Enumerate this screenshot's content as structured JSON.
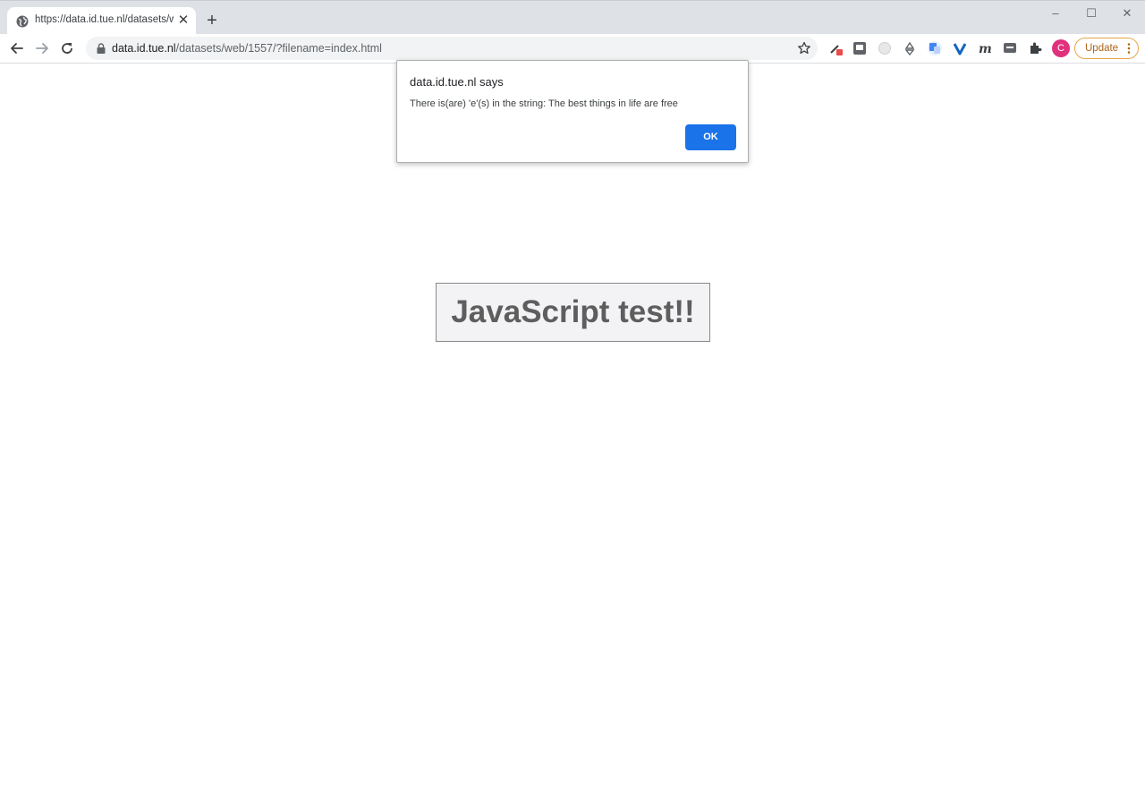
{
  "browser": {
    "tab": {
      "title": "https://data.id.tue.nl/datasets/web/1557/?filename=index.html",
      "close_glyph": "✕"
    },
    "new_tab_glyph": "+",
    "window_controls": {
      "minimize": "–",
      "maximize": "☐",
      "close": "✕"
    },
    "address": {
      "host": "data.id.tue.nl",
      "path": "/datasets/web/1557/?filename=index.html"
    },
    "profile_initial": "C",
    "update_label": "Update",
    "extension_icons": [
      "eyedropper-extension-icon",
      "square-extension-icon",
      "circle-extension-icon",
      "recycle-extension-icon",
      "translate-extension-icon",
      "v-extension-icon",
      "m-extension-icon",
      "chat-extension-icon",
      "puzzle-extension-icon"
    ]
  },
  "dialog": {
    "title": "data.id.tue.nl says",
    "message": "There is(are) 'e'(s) in the string: The best things in life are free",
    "ok_label": "OK"
  },
  "page": {
    "button_label": "JavaScript test!!"
  },
  "colors": {
    "accent": "#1a73e8",
    "avatar": "#e0317d",
    "update_border": "#e5a54b"
  }
}
